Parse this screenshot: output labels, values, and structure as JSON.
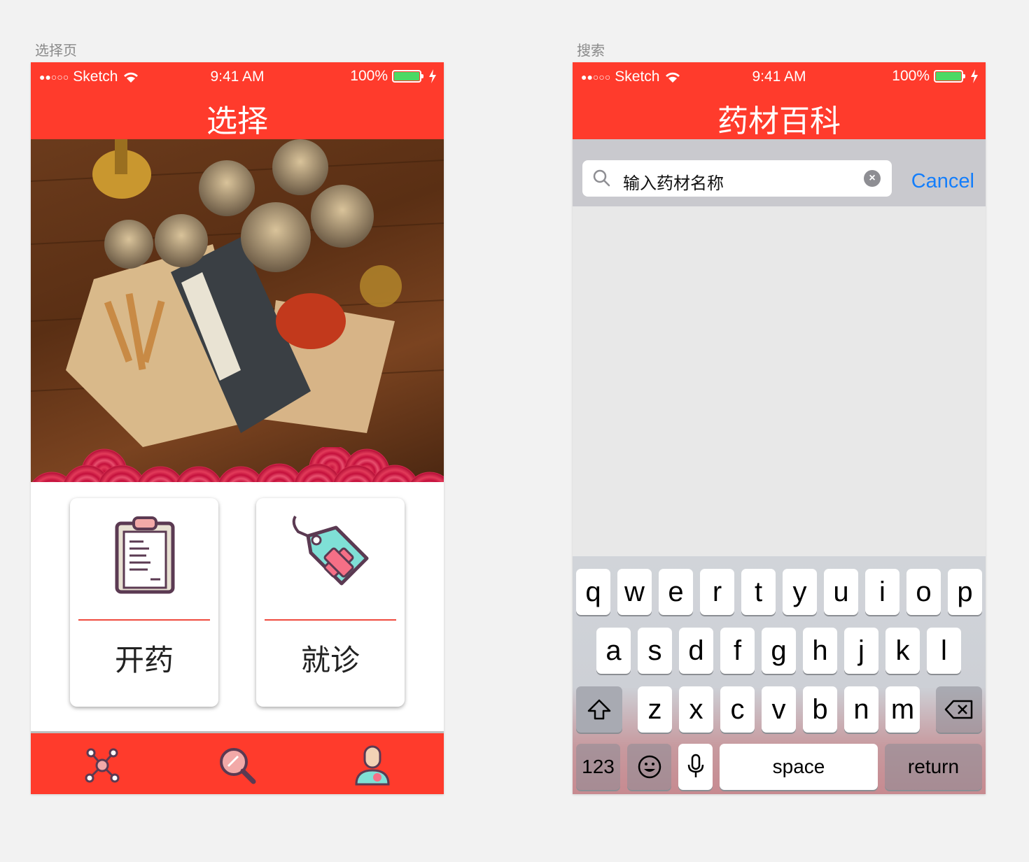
{
  "artboards": {
    "left_label": "选择页",
    "right_label": "搜索"
  },
  "status_bar": {
    "carrier": "Sketch",
    "time": "9:41 AM",
    "battery": "100%",
    "signal_icon": "signal-dots-icon",
    "wifi_icon": "wifi-icon",
    "battery_icon": "battery-icon",
    "charging_icon": "bolt-icon"
  },
  "choose_screen": {
    "title": "选择",
    "hero_image": "herbal-medicine-photo",
    "cards": [
      {
        "label": "开药",
        "icon": "clipboard-icon"
      },
      {
        "label": "就诊",
        "icon": "medical-tag-icon"
      }
    ],
    "tabs": [
      {
        "icon": "network-icon"
      },
      {
        "icon": "magnifier-icon"
      },
      {
        "icon": "doctor-icon"
      }
    ]
  },
  "search_screen": {
    "title": "药材百科",
    "search_value": "输入药材名称",
    "cancel_label": "Cancel"
  },
  "keyboard": {
    "row1": [
      "q",
      "w",
      "e",
      "r",
      "t",
      "y",
      "u",
      "i",
      "o",
      "p"
    ],
    "row2": [
      "a",
      "s",
      "d",
      "f",
      "g",
      "h",
      "j",
      "k",
      "l"
    ],
    "row3": [
      "z",
      "x",
      "c",
      "v",
      "b",
      "n",
      "m"
    ],
    "numbers_label": "123",
    "space_label": "space",
    "return_label": "return"
  },
  "colors": {
    "brand_red": "#ff3b2c",
    "divider_red": "#ef4b3f",
    "ios_blue": "#147efb",
    "battery_green": "#4cd964"
  }
}
